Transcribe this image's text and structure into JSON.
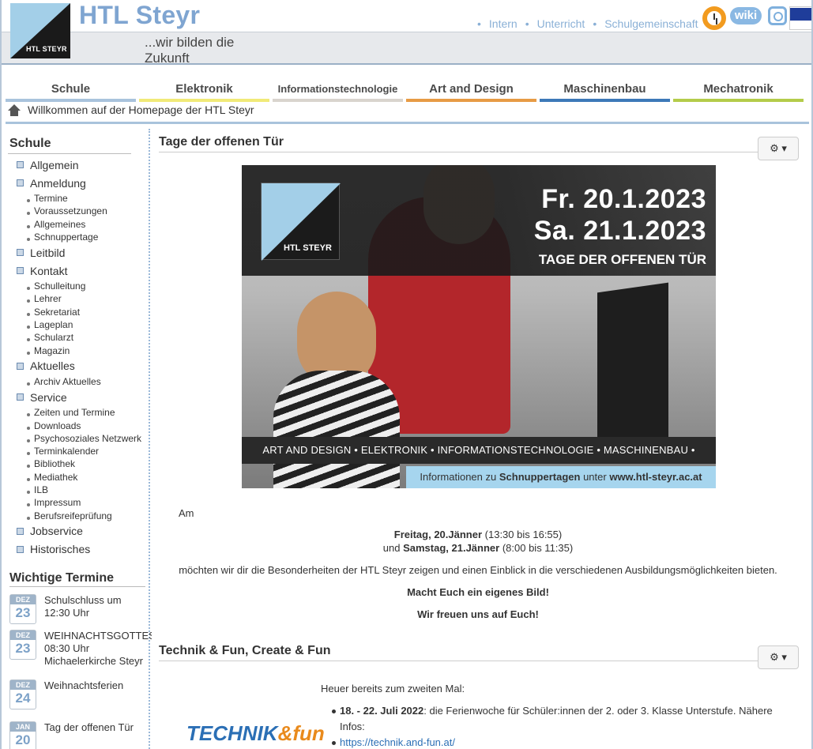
{
  "header": {
    "title": "HTL Steyr",
    "slogan": "...wir bilden die Zukunft",
    "logo_text": "HTL STEYR",
    "topnav": [
      "Intern",
      "Unterricht",
      "Schulgemeinschaft"
    ],
    "wiki_label": "wiki",
    "icons": [
      "clock-icon",
      "wiki-icon",
      "instagram-icon",
      "eu-flag-icon"
    ]
  },
  "categories": [
    {
      "label": "Schule",
      "color": "#a9c3dc"
    },
    {
      "label": "Elektronik",
      "color": "#f1ea78"
    },
    {
      "label": "Informationstechnologie",
      "color": "#d9d4ce"
    },
    {
      "label": "Art and Design",
      "color": "#e79b45"
    },
    {
      "label": "Maschinenbau",
      "color": "#3d79b8"
    },
    {
      "label": "Mechatronik",
      "color": "#b4cc4a"
    }
  ],
  "breadcrumb": "Willkommen auf der Homepage der HTL Steyr",
  "sidebar": {
    "heading": "Schule",
    "items": [
      {
        "label": "Allgemein",
        "sub": []
      },
      {
        "label": "Anmeldung",
        "sub": [
          "Termine",
          "Voraussetzungen",
          "Allgemeines",
          "Schnuppertage"
        ]
      },
      {
        "label": "Leitbild",
        "sub": []
      },
      {
        "label": "Kontakt",
        "sub": [
          "Schulleitung",
          "Lehrer",
          "Sekretariat",
          "Lageplan",
          "Schularzt",
          "Magazin"
        ]
      },
      {
        "label": "Aktuelles",
        "sub": [
          "Archiv Aktuelles"
        ]
      },
      {
        "label": "Service",
        "sub": [
          "Zeiten und Termine",
          "Downloads",
          "Psychosoziales Netzwerk",
          "Terminkalender",
          "Bibliothek",
          "Mediathek",
          "ILB",
          "Impressum",
          "Berufsreifeprüfung"
        ]
      },
      {
        "label": "Jobservice",
        "sub": []
      },
      {
        "label": "Historisches",
        "sub": []
      }
    ]
  },
  "termine": {
    "heading": "Wichtige Termine",
    "items": [
      {
        "month": "DEZ",
        "day": "23",
        "lines": [
          "Schulschluss um",
          "12:30 Uhr"
        ]
      },
      {
        "month": "DEZ",
        "day": "23",
        "lines": [
          "WEIHNACHTSGOTTES",
          "08:30 Uhr",
          "Michaelerkirche Steyr"
        ]
      },
      {
        "month": "DEZ",
        "day": "24",
        "lines": [
          "Weihnachtsferien"
        ]
      },
      {
        "month": "JAN",
        "day": "20",
        "lines": [
          "Tag der offenen Tür"
        ]
      }
    ]
  },
  "article1": {
    "title": "Tage der offenen Tür",
    "gear": "⚙ ▾",
    "banner": {
      "logo": "HTL STEYR",
      "date1": "Fr.  20.1.2023",
      "date2": "Sa. 21.1.2023",
      "headline": "TAGE DER OFFENEN TÜR",
      "stripe": "ART AND DESIGN • ELEKTRONIK • INFORMATIONSTECHNOLOGIE • MASCHINENBAU • MECHATRONIK",
      "info_pre": "Informationen zu",
      "info_bold1": "Schnuppertagen",
      "info_mid": "unter",
      "info_bold2": "www.htl-steyr.ac.at"
    },
    "am": "Am",
    "day1_bold": "Freitag, 20.Jänner",
    "day1_time": " (13:30 bis 16:55)",
    "day2_pre": "und ",
    "day2_bold": "Samstag, 21.Jänner",
    "day2_time": " (8:00 bis 11:35)",
    "text": "möchten wir dir die Besonderheiten der HTL Steyr zeigen und einen Einblick in die verschiedenen Ausbildungsmöglichkeiten bieten.",
    "bold1": "Macht Euch ein eigenes Bild!",
    "bold2": "Wir freuen uns auf Euch!"
  },
  "article2": {
    "title": "Technik & Fun, Create & Fun",
    "gear": "⚙ ▾",
    "logo_a": "TECHNIK",
    "logo_b": "&fun",
    "intro": "Heuer bereits zum zweiten Mal:",
    "li1_bold": "18. - 22. Juli 2022",
    "li1_text": ": die Ferienwoche für Schüler:innen der 2. oder 3. Klasse Unterstufe. Nähere Infos:",
    "li2_link": "https://technik.and-fun.at/"
  }
}
